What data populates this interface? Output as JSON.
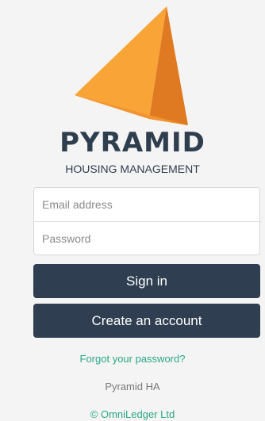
{
  "brand": {
    "logo_icon": "pyramid-logo-icon",
    "name": "PYRAMID",
    "tagline": "HOUSING MANAGEMENT",
    "colors": {
      "primary": "#2f3e50",
      "accent": "#2aa784",
      "logo_light": "#f7a33a",
      "logo_dark": "#d9701c"
    }
  },
  "form": {
    "email_placeholder": "Email address",
    "password_placeholder": "Password",
    "sign_in_label": "Sign in",
    "create_account_label": "Create an account",
    "forgot_password_label": "Forgot your password?"
  },
  "footer": {
    "org_name": "Pyramid HA",
    "copyright": "© OmniLedger Ltd"
  }
}
